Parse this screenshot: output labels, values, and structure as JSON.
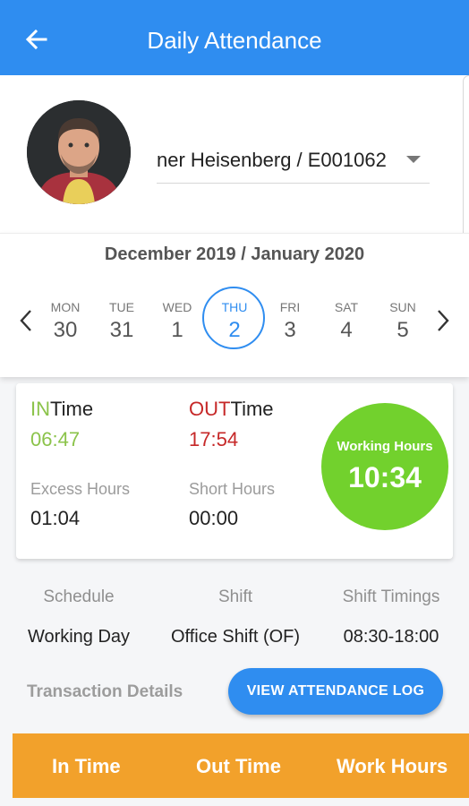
{
  "header": {
    "title": "Daily Attendance",
    "back_icon": "arrow-left-icon"
  },
  "profile": {
    "employee_value": "ner  Heisenberg / E001062"
  },
  "calendar": {
    "month_label": "December 2019 / January 2020",
    "days": [
      {
        "name": "MON",
        "num": "30"
      },
      {
        "name": "TUE",
        "num": "31"
      },
      {
        "name": "WED",
        "num": "1"
      },
      {
        "name": "THU",
        "num": "2"
      },
      {
        "name": "FRI",
        "num": "3"
      },
      {
        "name": "SAT",
        "num": "4"
      },
      {
        "name": "SUN",
        "num": "5"
      }
    ],
    "selected_index": 3
  },
  "time_card": {
    "in_prefix": "IN",
    "in_suffix": "Time",
    "in_value": "06:47",
    "out_prefix": "OUT",
    "out_suffix": "Time",
    "out_value": "17:54",
    "excess_label": "Excess Hours",
    "excess_value": "01:04",
    "short_label": "Short Hours",
    "short_value": "00:00",
    "working_label": "Working Hours",
    "working_value": "10:34"
  },
  "info": {
    "schedule_label": "Schedule",
    "schedule_value": "Working Day",
    "shift_label": "Shift",
    "shift_value": "Office Shift (OF)",
    "timings_label": "Shift Timings",
    "timings_value": "08:30-18:00"
  },
  "transactions": {
    "label": "Transaction Details",
    "log_button": "VIEW ATTENDANCE LOG",
    "columns": [
      "In Time",
      "Out Time",
      "Work Hours"
    ]
  },
  "colors": {
    "primary": "#2f8df0",
    "in_green": "#8bc34a",
    "out_red": "#c62828",
    "hours_circle": "#72d12d",
    "table_header": "#f2a12b"
  }
}
